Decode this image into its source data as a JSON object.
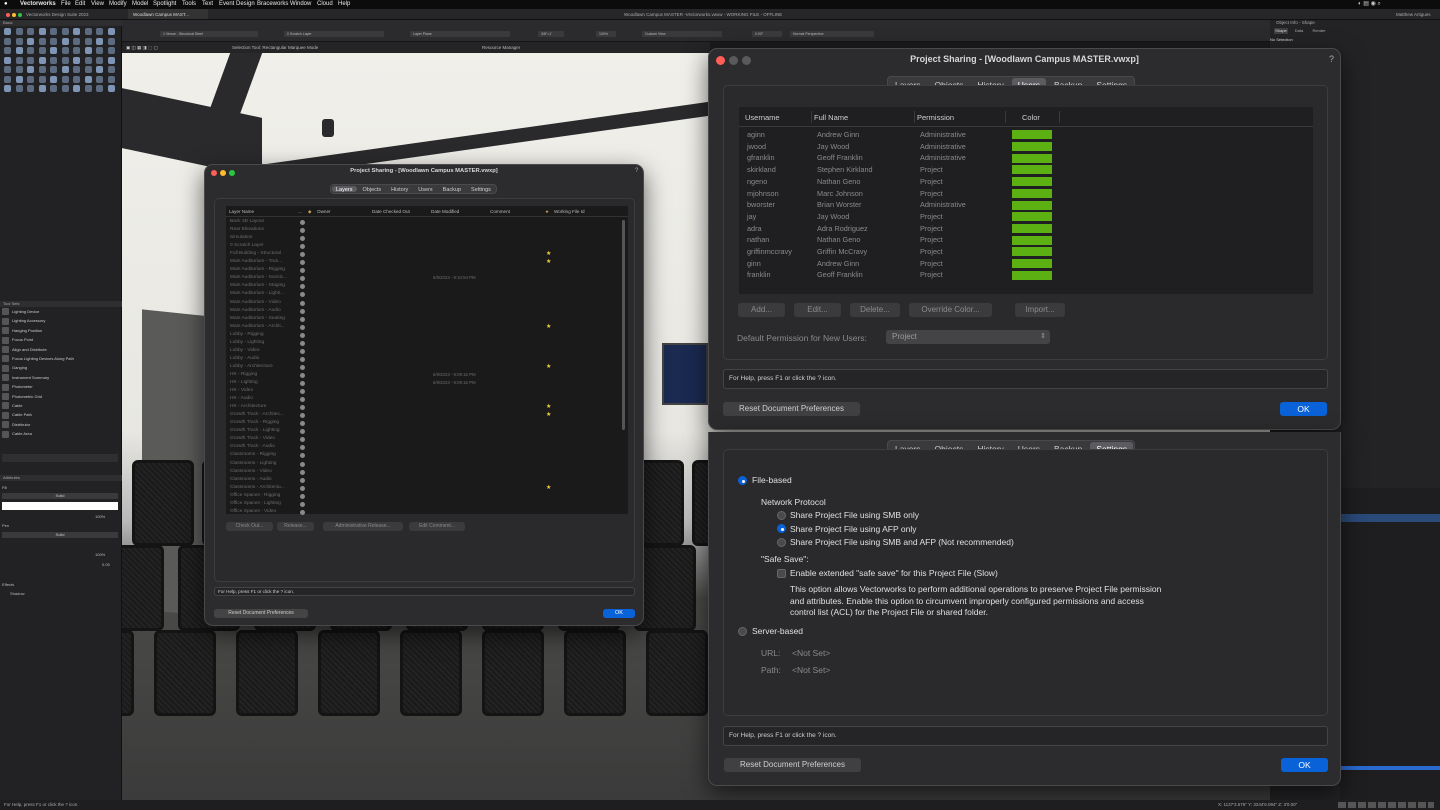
{
  "menubar": {
    "items": [
      "Vectorworks",
      "File",
      "Edit",
      "View",
      "Modify",
      "Model",
      "Spotlight",
      "Tools",
      "Text",
      "Event Design",
      "Braceworks",
      "Window",
      "Cloud",
      "Help"
    ],
    "window_title": "Woodlawn Campus MASTER -Vectorworks.vwxw - WORKING FILE - OFFLINE",
    "user": "Matthew Artigues"
  },
  "app": {
    "suite_title": "Vectorworks Design Suite 2023",
    "doc_tab": "Woodlawn Campus MAST...",
    "basic_palette": "Basic",
    "tool_sets_palette": "Tool Sets",
    "attributes_palette": "Attributes",
    "resource_manager": "Resource Manager",
    "mode_hint": "Selection Tool: Rectangular Marquee Mode"
  },
  "toolbar": {
    "class_field": "1 Venue - Structural Steel",
    "layer_field": "0 Scratch Layer",
    "plane_field": "Layer Plane",
    "zoom_field": "100%",
    "view_field": "Custom View",
    "render_field": "Normal Perspective",
    "angle_field": "0.00°",
    "scale_field": "3/8\"=1'"
  },
  "tool_sets": [
    "Lighting Device",
    "Lighting Accessory",
    "Hanging Position",
    "Focus Point",
    "Align and Distribute",
    "Focus Lighting Devices Along Path",
    "Ganging",
    "Instrument Summary",
    "Photometer",
    "Photometric Grid",
    "Cable",
    "Cable Path",
    "Distributor",
    "Cable Area"
  ],
  "attributes": {
    "fill_label": "Fill",
    "fill_value": "Solid",
    "pen_label": "Pen",
    "pen_value": "Solid",
    "opacity1": "100%",
    "opacity2": "100%",
    "thickness": "0.05",
    "effects_label": "Effects",
    "shadow_label": "Shadow"
  },
  "object_info": {
    "title": "Object Info - Shape",
    "tabs": [
      "Shape",
      "Data",
      "Render"
    ],
    "status": "No Selection"
  },
  "dialog_users": {
    "title": "Project Sharing - [Woodlawn Campus MASTER.vwxp]",
    "help_icon": "?",
    "tabs": [
      "Layers",
      "Objects",
      "History",
      "Users",
      "Backup",
      "Settings"
    ],
    "selected_tab": "Users",
    "columns": [
      "Username",
      "Full Name",
      "Permission",
      "Color"
    ],
    "rows": [
      {
        "username": "aginn",
        "full_name": "Andrew Ginn",
        "permission": "Administrative"
      },
      {
        "username": "jwood",
        "full_name": "Jay Wood",
        "permission": "Administrative"
      },
      {
        "username": "gfranklin",
        "full_name": "Geoff Franklin",
        "permission": "Administrative"
      },
      {
        "username": "skirkland",
        "full_name": "Stephen Kirkland",
        "permission": "Project"
      },
      {
        "username": "ngeno",
        "full_name": "Nathan Geno",
        "permission": "Project"
      },
      {
        "username": "mjohnson",
        "full_name": "Marc Johnson",
        "permission": "Project"
      },
      {
        "username": "bworster",
        "full_name": "Brian Worster",
        "permission": "Administrative"
      },
      {
        "username": "jay",
        "full_name": "Jay Wood",
        "permission": "Project"
      },
      {
        "username": "adra",
        "full_name": "Adra Rodriguez",
        "permission": "Project"
      },
      {
        "username": "nathan",
        "full_name": "Nathan Geno",
        "permission": "Project"
      },
      {
        "username": "griffinmccravy",
        "full_name": "Griffin McCravy",
        "permission": "Project"
      },
      {
        "username": "ginn",
        "full_name": "Andrew Ginn",
        "permission": "Project"
      },
      {
        "username": "franklin",
        "full_name": "Geoff Franklin",
        "permission": "Project"
      }
    ],
    "user_color": "#5db012",
    "buttons": {
      "add": "Add...",
      "edit": "Edit...",
      "delete": "Delete...",
      "override": "Override Color...",
      "import": "Import..."
    },
    "default_perm_label": "Default Permission for New Users:",
    "default_perm_value": "Project",
    "help_text": "For Help, press F1 or click the ? icon.",
    "reset_label": "Reset Document Preferences",
    "ok_label": "OK"
  },
  "dialog_settings": {
    "tabs": [
      "Layers",
      "Objects",
      "History",
      "Users",
      "Backup",
      "Settings"
    ],
    "selected_tab": "Settings",
    "file_based": "File-based",
    "network_protocol": "Network Protocol",
    "smb_only": "Share Project File using SMB only",
    "afp_only": "Share Project File using AFP only",
    "smb_afp": "Share Project File using SMB and AFP (Not recommended)",
    "safe_save_heading": "\"Safe Save\":",
    "safe_save_check": "Enable extended \"safe save\" for this Project File (Slow)",
    "safe_save_desc1": "This option allows Vectorworks to perform additional operations to preserve Project File permission",
    "safe_save_desc2": "and attributes. Enable this option to circumvent improperly configured permissions and access",
    "safe_save_desc3": "control list (ACL) for the Project File or shared folder.",
    "server_based": "Server-based",
    "url_label": "URL:",
    "url_value": "<Not Set>",
    "path_label": "Path:",
    "path_value": "<Not Set>",
    "help_text": "For Help, press F1 or click the ? icon.",
    "reset_label": "Reset Document Preferences",
    "ok_label": "OK"
  },
  "dialog_layers": {
    "title": "Project Sharing - [Woodlawn Campus MASTER.vwxp]",
    "help_icon": "?",
    "tabs": [
      "Layers",
      "Objects",
      "History",
      "Users",
      "Backup",
      "Settings"
    ],
    "selected_tab": "Layers",
    "columns": [
      "Layer Name",
      "...",
      "Owner",
      "Date Checked Out",
      "Date Modified",
      "Comment",
      "Working File Id"
    ],
    "rows": [
      {
        "name": "Back 3D Layout",
        "date": "",
        "star": false
      },
      {
        "name": "Rear Elevations",
        "date": "",
        "star": false
      },
      {
        "name": "Simulation",
        "date": "",
        "star": false
      },
      {
        "name": "0 Scratch Layer",
        "date": "",
        "star": false
      },
      {
        "name": "Full Building - Structural",
        "date": "",
        "star": true
      },
      {
        "name": "Main Auditorium - Trus...",
        "date": "",
        "star": true
      },
      {
        "name": "Main Auditorium - Rigging",
        "date": "",
        "star": false
      },
      {
        "name": "Main Auditorium - Scenic...",
        "date": "6/9/2023 - 9:10:54 PM",
        "star": false
      },
      {
        "name": "Main Auditorium - Staging",
        "date": "",
        "star": false
      },
      {
        "name": "Main Auditorium - Lighti...",
        "date": "",
        "star": false
      },
      {
        "name": "Main Auditorium - Video",
        "date": "",
        "star": false
      },
      {
        "name": "Main Auditorium - Audio",
        "date": "",
        "star": false
      },
      {
        "name": "Main Auditorium - Seating",
        "date": "",
        "star": false
      },
      {
        "name": "Main Auditorium - Archit...",
        "date": "",
        "star": true
      },
      {
        "name": "Lobby - Rigging",
        "date": "",
        "star": false
      },
      {
        "name": "Lobby - Lighting",
        "date": "",
        "star": false
      },
      {
        "name": "Lobby - Video",
        "date": "",
        "star": false
      },
      {
        "name": "Lobby - Audio",
        "date": "",
        "star": false
      },
      {
        "name": "Lobby - Architecture",
        "date": "",
        "star": true
      },
      {
        "name": "HK - Rigging",
        "date": "6/9/2023 - 9:09:16 PM",
        "star": false
      },
      {
        "name": "HK - Lighting",
        "date": "6/9/2023 - 9:09:16 PM",
        "star": false
      },
      {
        "name": "HK - Video",
        "date": "",
        "star": false
      },
      {
        "name": "HK - Audio",
        "date": "",
        "star": false
      },
      {
        "name": "HK - Architecture",
        "date": "",
        "star": true
      },
      {
        "name": "Growth Track - Architec...",
        "date": "",
        "star": true
      },
      {
        "name": "Growth Track - Rigging",
        "date": "",
        "star": false
      },
      {
        "name": "Growth Track - Lighting",
        "date": "",
        "star": false
      },
      {
        "name": "Growth Track - Video",
        "date": "",
        "star": false
      },
      {
        "name": "Growth Track - Audio",
        "date": "",
        "star": false
      },
      {
        "name": "Classrooms - Rigging",
        "date": "",
        "star": false
      },
      {
        "name": "Classrooms - Lighting",
        "date": "",
        "star": false
      },
      {
        "name": "Classrooms - Video",
        "date": "",
        "star": false
      },
      {
        "name": "Classrooms - Audio",
        "date": "",
        "star": false
      },
      {
        "name": "Classrooms - Architectu...",
        "date": "",
        "star": true
      },
      {
        "name": "Office Spaces - Rigging",
        "date": "",
        "star": false
      },
      {
        "name": "Office Spaces - Lighting",
        "date": "",
        "star": false
      },
      {
        "name": "Office Spaces - Video",
        "date": "",
        "star": false
      }
    ],
    "buttons": {
      "check_out": "Check Out...",
      "release": "Release...",
      "admin_release": "Administrative Release...",
      "edit_comment": "Edit Comment..."
    },
    "help_text": "For Help, press F1 or click the ? icon.",
    "reset_label": "Reset Document Preferences",
    "ok_label": "OK"
  },
  "statusbar": {
    "left": "For Help, press F1 or click the ? icon.",
    "coords": "X: 1137'3.576\"   Y: 3244'6.094\"   Z: 3'0.00\""
  }
}
